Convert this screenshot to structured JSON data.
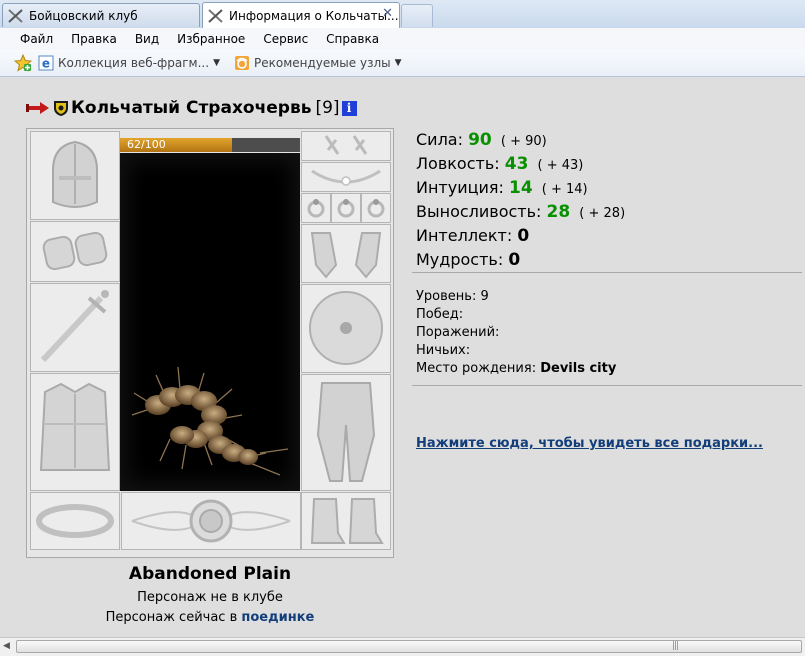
{
  "tabs": [
    {
      "label": "Бойцовский клуб",
      "active": false
    },
    {
      "label": "Информация о Кольчаты...",
      "active": true,
      "close": "✕"
    }
  ],
  "menu": [
    "Файл",
    "Правка",
    "Вид",
    "Избранное",
    "Сервис",
    "Справка"
  ],
  "favorites": [
    {
      "label": "Коллекция веб-фрагм...",
      "icon": "ie-icon"
    },
    {
      "label": "Рекомендуемые узлы",
      "icon": "suggested-sites-icon"
    }
  ],
  "character": {
    "name": "Кольчатый Страхочервь",
    "level": "[9]",
    "info_glyph": "i",
    "hp_text": "62/100",
    "hp_fraction": 0.62
  },
  "stats": [
    {
      "label": "Сила:",
      "value": "90",
      "bonus": "( + 90)"
    },
    {
      "label": "Ловкость:",
      "value": "43",
      "bonus": "( + 43)"
    },
    {
      "label": "Интуиция:",
      "value": "14",
      "bonus": "( + 14)"
    },
    {
      "label": "Выносливость:",
      "value": "28",
      "bonus": "( + 28)"
    },
    {
      "label": "Интеллект:",
      "value": "0",
      "bonus": ""
    },
    {
      "label": "Мудрость:",
      "value": "0",
      "bonus": ""
    }
  ],
  "info": {
    "level_label": "Уровень:",
    "level_value": "9",
    "wins_label": "Побед:",
    "losses_label": "Поражений:",
    "draws_label": "Ничьих:",
    "birthplace_label": "Место рождения:",
    "birthplace_value": "Devils city"
  },
  "gifts_link": "Нажмите сюда, чтобы увидеть все подарки...",
  "location": "Abandoned Plain",
  "status_club": "Персонаж не в клубе",
  "status_now_prefix": "Персонаж сейчас в",
  "status_now_link": "поединке",
  "colors": {
    "stat_value": "#089000",
    "link": "#123e7a",
    "hp_bar": "#d49a24"
  }
}
